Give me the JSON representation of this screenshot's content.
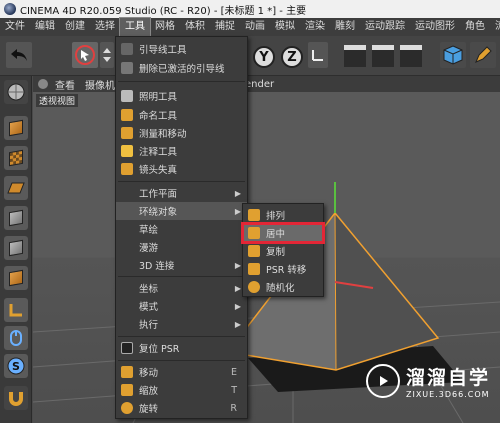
{
  "window": {
    "title": "CINEMA 4D R20.059 Studio (RC - R20) - [未标题 1 *] - 主要"
  },
  "menubar": [
    "文件",
    "编辑",
    "创建",
    "选择",
    "工具",
    "网格",
    "体积",
    "捕捉",
    "动画",
    "模拟",
    "渲染",
    "雕刻",
    "运动跟踪",
    "运动图形",
    "角色",
    "流水线"
  ],
  "toolbar": {
    "axis_y": "Y",
    "axis_z": "Z"
  },
  "viewport": {
    "menu": [
      "查看",
      "摄像机"
    ],
    "render_label": "ender",
    "label": "透视视图"
  },
  "tools_menu": {
    "items": [
      {
        "label": "引导线工具",
        "icon": "guide-line-icon"
      },
      {
        "label": "删除已激活的引导线",
        "icon": "delete-guide-icon"
      },
      {
        "label": "照明工具",
        "icon": "lighting-icon"
      },
      {
        "label": "命名工具",
        "icon": "naming-icon"
      },
      {
        "label": "测量和移动",
        "icon": "measure-icon"
      },
      {
        "label": "注释工具",
        "icon": "annotation-icon"
      },
      {
        "label": "镜头失真",
        "icon": "lens-distortion-icon"
      },
      {
        "label": "工作平面",
        "submenu": true
      },
      {
        "label": "环绕对象",
        "submenu": true,
        "highlight": true
      },
      {
        "label": "草绘"
      },
      {
        "label": "漫游"
      },
      {
        "label": "3D 连接",
        "submenu": true
      },
      {
        "label": "坐标",
        "submenu": true
      },
      {
        "label": "模式",
        "submenu": true
      },
      {
        "label": "执行",
        "submenu": true
      },
      {
        "label": "复位 PSR",
        "icon": "reset-psr-icon"
      },
      {
        "label": "移动",
        "shortcut": "E",
        "icon": "move-icon"
      },
      {
        "label": "缩放",
        "shortcut": "T",
        "icon": "scale-icon"
      },
      {
        "label": "旋转",
        "shortcut": "R",
        "icon": "rotate-icon"
      }
    ]
  },
  "arrange_submenu": {
    "items": [
      {
        "label": "排列"
      },
      {
        "label": "居中",
        "selected": true
      },
      {
        "label": "复制"
      },
      {
        "label": "PSR 转移"
      },
      {
        "label": "随机化"
      }
    ]
  },
  "watermark": {
    "brand": "溜溜自学",
    "site": "ZIXUE.3D66.COM"
  },
  "colors": {
    "accent_orange": "#f0a030",
    "selection_red": "#e32636",
    "menu_bg": "#3c3c3c"
  }
}
